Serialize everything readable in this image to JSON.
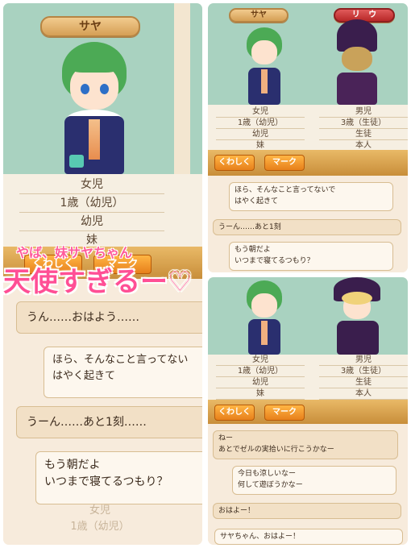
{
  "collage_left": {
    "name_tag": "サヤ",
    "info": [
      "女児",
      "1歳（幼児）",
      "幼児",
      "妹"
    ],
    "buttons": [
      "くわしく",
      "マーク"
    ],
    "chat": [
      "うん……おはよう……",
      "ほら、そんなこと言ってない\nはやく起きて",
      "うーん……あと1刻……",
      "もう朝だよ\nいつまで寝てるつもり？"
    ],
    "faded_info": [
      "女児",
      "1歳（幼児）"
    ]
  },
  "collage_right_top": {
    "name_left": "サヤ",
    "name_right": "リ",
    "name_right_extra": "ウ",
    "info_left": [
      "女児",
      "1歳（幼児）",
      "幼児",
      "妹"
    ],
    "info_right": [
      "男児",
      "3歳（生徒）",
      "生徒",
      "本人"
    ],
    "buttons": [
      "くわしく",
      "マーク"
    ],
    "chat": [
      "ほら、そんなこと言ってないで\nはやく起きて",
      "うーん……あと1刻",
      "もう朝だよ\nいつまで寝てるつもり？"
    ]
  },
  "collage_right_bottom": {
    "info_left": [
      "女児",
      "1歳（幼児）",
      "幼児",
      "妹"
    ],
    "info_right": [
      "男児",
      "3歳（生徒）",
      "生徒",
      "本人"
    ],
    "buttons": [
      "くわしく",
      "マーク"
    ],
    "chat": [
      "ねー\nあとでゼルの実拾いに行こうかなー",
      "今日も涼しいなー\n何して遊ぼうかなー",
      "おはよー！",
      "サヤちゃん、おはよー！"
    ]
  },
  "overlay": {
    "small": "やば、妹サヤちゃん",
    "main": "天使すぎるー",
    "heart": "♡"
  },
  "colors": {
    "scene_bg": "#a9d2c0",
    "accent_orange": "#e7801b",
    "overlay_pink": "#ff4f95"
  }
}
